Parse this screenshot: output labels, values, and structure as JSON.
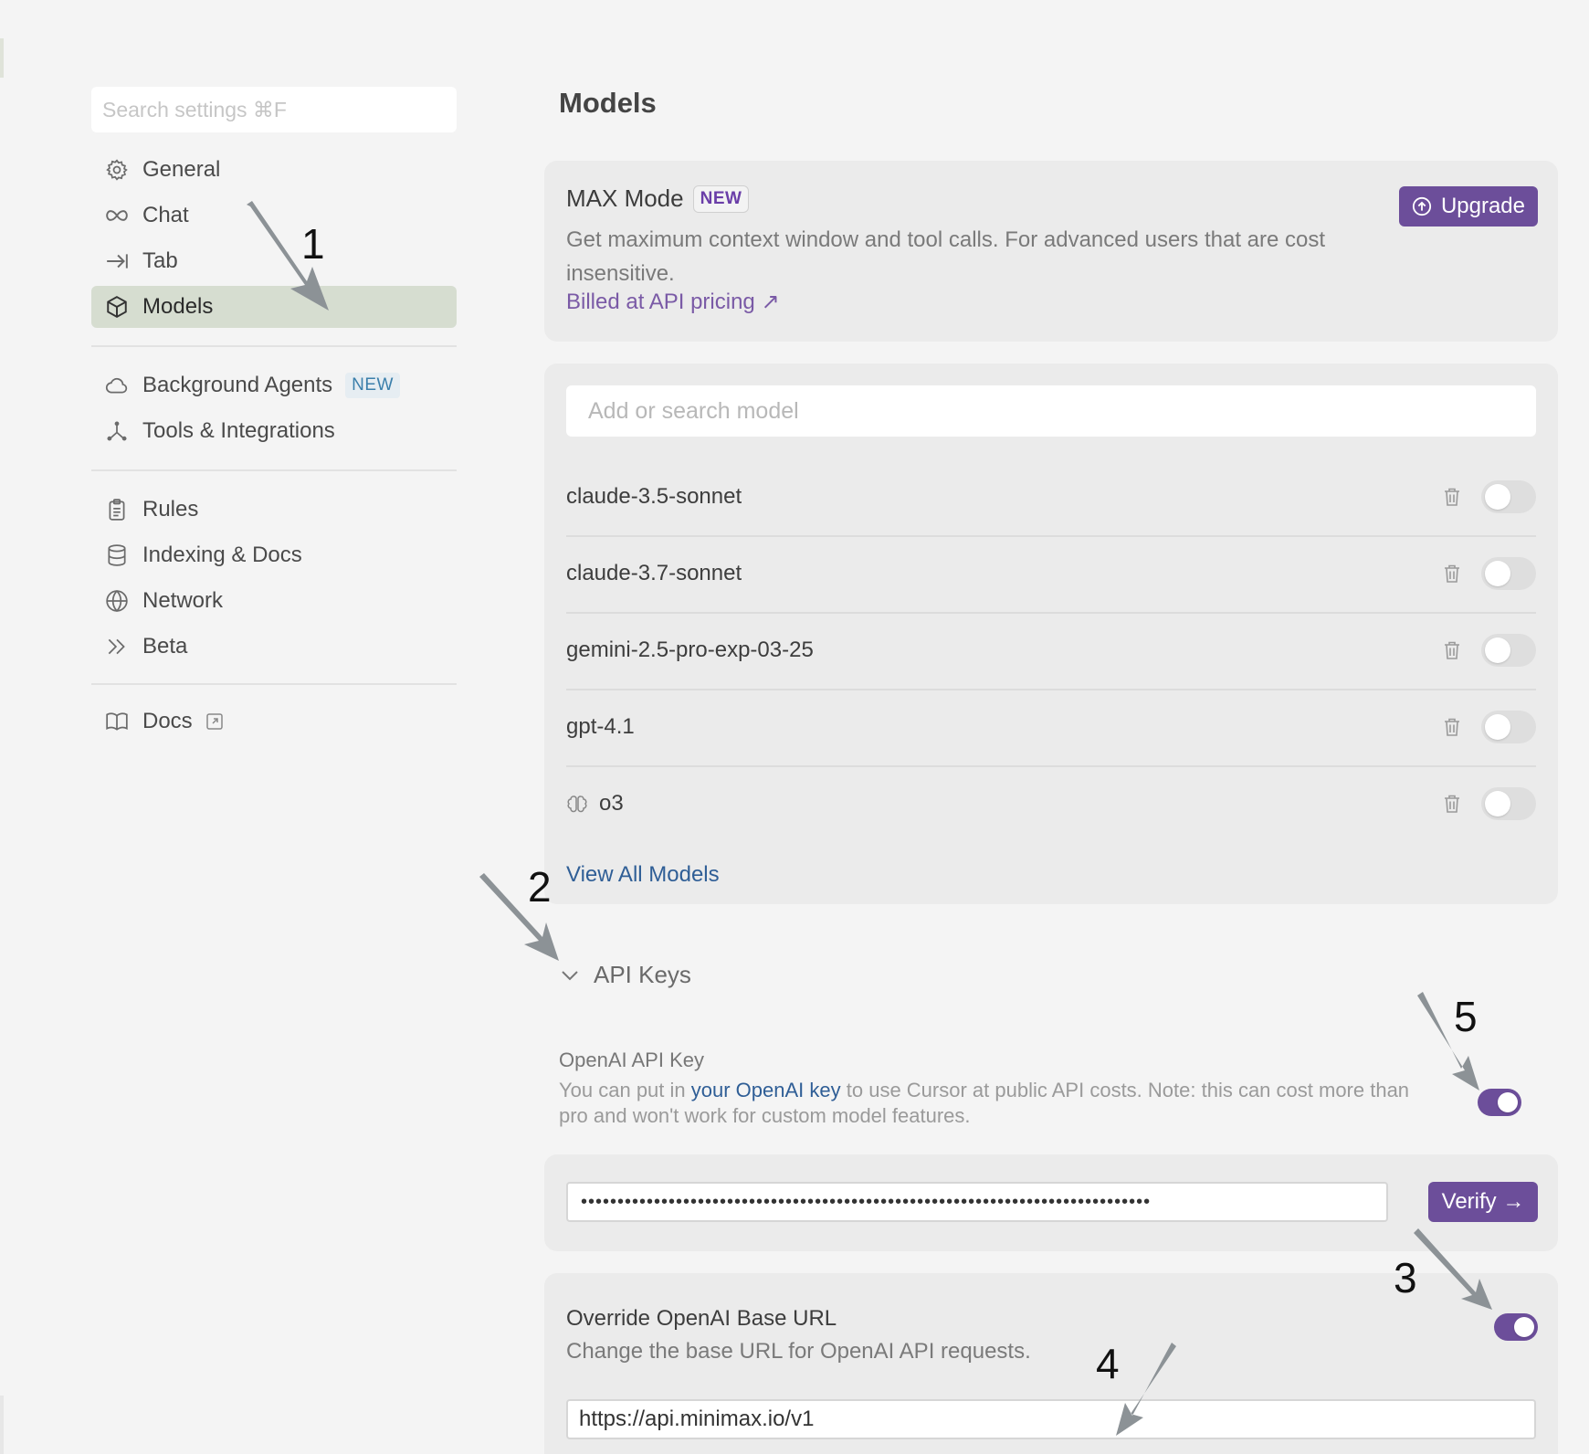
{
  "sidebar": {
    "search_placeholder": "Search settings ⌘F",
    "groups": [
      [
        {
          "label": "General",
          "icon": "gear-icon"
        },
        {
          "label": "Chat",
          "icon": "infinity-icon"
        },
        {
          "label": "Tab",
          "icon": "arrow-right-bar-icon"
        },
        {
          "label": "Models",
          "icon": "cube-icon",
          "active": true
        }
      ],
      [
        {
          "label": "Background Agents",
          "icon": "cloud-icon",
          "badge": "NEW"
        },
        {
          "label": "Tools & Integrations",
          "icon": "nodes-icon"
        }
      ],
      [
        {
          "label": "Rules",
          "icon": "clipboard-icon"
        },
        {
          "label": "Indexing & Docs",
          "icon": "database-icon"
        },
        {
          "label": "Network",
          "icon": "globe-icon"
        },
        {
          "label": "Beta",
          "icon": "double-chevron-icon"
        }
      ],
      [
        {
          "label": "Docs",
          "icon": "book-icon"
        }
      ]
    ]
  },
  "main": {
    "title": "Models",
    "max_mode": {
      "title": "MAX Mode",
      "badge": "NEW",
      "description": "Get maximum context window and tool calls. For advanced users that are cost insensitive.",
      "link": "Billed at API pricing ↗",
      "upgrade_label": "Upgrade"
    },
    "models": {
      "search_placeholder": "Add or search model",
      "items": [
        {
          "name": "claude-3.5-sonnet",
          "enabled": false
        },
        {
          "name": "claude-3.7-sonnet",
          "enabled": false
        },
        {
          "name": "gemini-2.5-pro-exp-03-25",
          "enabled": false
        },
        {
          "name": "gpt-4.1",
          "enabled": false
        },
        {
          "name": "o3",
          "enabled": false,
          "icon": "brain-icon"
        }
      ],
      "view_all": "View All Models"
    },
    "api_keys": {
      "header": "API Keys",
      "openai_title": "OpenAI API Key",
      "openai_desc_pre": "You can put in ",
      "openai_desc_link": "your OpenAI key",
      "openai_desc_post": " to use Cursor at public API costs. Note: this can cost more than pro and won't work for custom model features.",
      "openai_enabled": true,
      "key_value": "••••••••••••••••••••••••••••••••••••••••••••••••••••••••••••••••••••••••••••••",
      "verify_label": "Verify →",
      "override_title": "Override OpenAI Base URL",
      "override_desc": "Change the base URL for OpenAI API requests.",
      "override_enabled": true,
      "base_url": "https://api.minimax.io/v1"
    }
  },
  "annotations": [
    "1",
    "2",
    "3",
    "4",
    "5"
  ],
  "colors": {
    "accent": "#6c4e9a",
    "active_nav": "#d6ddd0",
    "link": "#2f5e96"
  }
}
